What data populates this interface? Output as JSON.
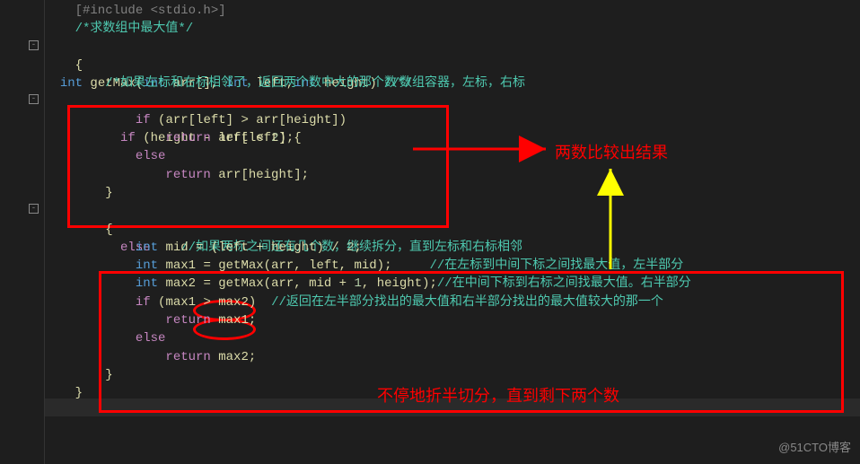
{
  "code": {
    "0": "    #include <stdio.h>",
    "1": "    /*求数组中最大值*/",
    "2": "int getMax(int arr[], int left,int height) //数组容器，左标，右标",
    "3": "    {",
    "4": "        /*如果左标和右标相邻了，返回两个数中大的那个数*/",
    "5": "        if (height - left < 2) {",
    "6": "            if (arr[left] > arr[height])",
    "7": "                return arr[left];",
    "8": "            else",
    "9": "                return arr[height];",
    "10": "        }",
    "11": "        else    //如果两标之间还有几个数，继续拆分，直到左标和右标相邻",
    "12": "        {",
    "13": "            int mid = (left + height) / 2;",
    "14": "            int max1 = getMax(arr, left, mid);     //在左标到中间下标之间找最大值，左半部分",
    "15": "            int max2 = getMax(arr, mid + 1, height);//在中间下标到右标之间找最大值。右半部分",
    "16": "            if (max1 > max2)  //返回在左半部分找出的最大值和右半部分找出的最大值较大的那一个",
    "17": "                return max1;",
    "18": "            else",
    "19": "                return max2;",
    "20": "        }",
    "21": "    }"
  },
  "annotations": {
    "compare_result": "两数比较出结果",
    "halve_split": "不停地折半切分，直到剩下两个数"
  },
  "watermark": "@51CTO博客"
}
